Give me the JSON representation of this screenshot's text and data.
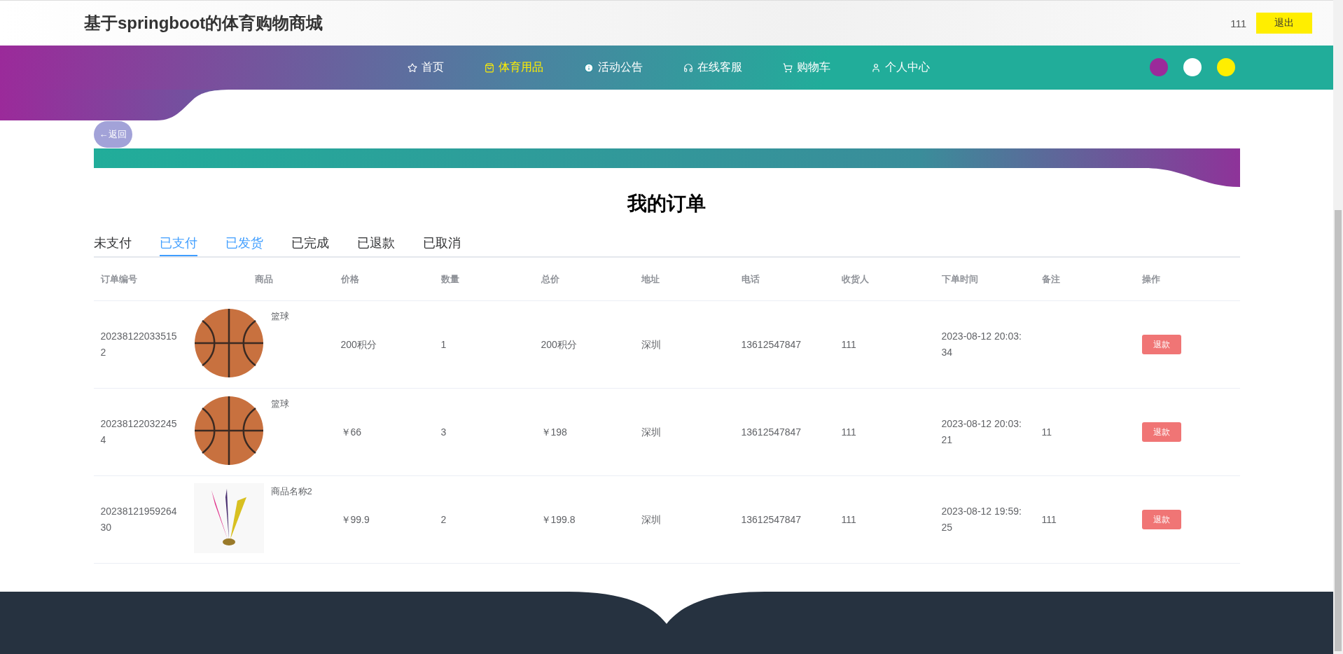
{
  "header": {
    "title": "基于springboot的体育购物商城",
    "user": "111",
    "logout": "退出"
  },
  "nav": [
    {
      "label": "首页",
      "kind": "star",
      "selected": false
    },
    {
      "label": "体育用品",
      "kind": "bag",
      "selected": true
    },
    {
      "label": "活动公告",
      "kind": "alert",
      "selected": false
    },
    {
      "label": "在线客服",
      "kind": "headset",
      "selected": false
    },
    {
      "label": "购物车",
      "kind": "cart",
      "selected": false
    },
    {
      "label": "个人中心",
      "kind": "user",
      "selected": false
    }
  ],
  "theme_dots": [
    {
      "color": "#9b2a9a"
    },
    {
      "color": "#ffffff"
    },
    {
      "color": "#ffee00"
    }
  ],
  "back_button": "←返回",
  "page_title": "我的订单",
  "tabs": [
    {
      "label": "未支付",
      "selected": false,
      "hovered": false
    },
    {
      "label": "已支付",
      "selected": true,
      "hovered": false
    },
    {
      "label": "已发货",
      "selected": false,
      "hovered": true
    },
    {
      "label": "已完成",
      "selected": false,
      "hovered": false
    },
    {
      "label": "已退款",
      "selected": false,
      "hovered": false
    },
    {
      "label": "已取消",
      "selected": false,
      "hovered": false
    }
  ],
  "table": {
    "columns": [
      "订单编号",
      "商品",
      "价格",
      "数量",
      "总价",
      "地址",
      "电话",
      "收货人",
      "下单时间",
      "备注",
      "操作"
    ],
    "rows": [
      {
        "order_no": "202381220335152",
        "product": {
          "name": "篮球",
          "kind": "ball"
        },
        "price": "200积分",
        "quantity": "1",
        "total": "200积分",
        "address": "深圳",
        "phone": "13612547847",
        "recipient": "111",
        "time": "2023-08-12 20:03:34",
        "action": "退款"
      },
      {
        "order_no": "202381220322454",
        "product": {
          "name": "篮球",
          "kind": "ball"
        },
        "price": "￥66",
        "quantity": "3",
        "total": "￥198",
        "address": "深圳",
        "phone": "13612547847",
        "recipient": "111",
        "time": "2023-08-12 20:03:21",
        "note": "11",
        "action": "退款"
      },
      {
        "order_no": "2023812195926430",
        "product": {
          "name": "商品名称2",
          "kind": "feather"
        },
        "price": "￥99.9",
        "quantity": "2",
        "total": "￥199.8",
        "address": "深圳",
        "phone": "13612547847",
        "recipient": "111",
        "time": "2023-08-12 19:59:25",
        "note": "111",
        "action": "退款"
      }
    ]
  }
}
